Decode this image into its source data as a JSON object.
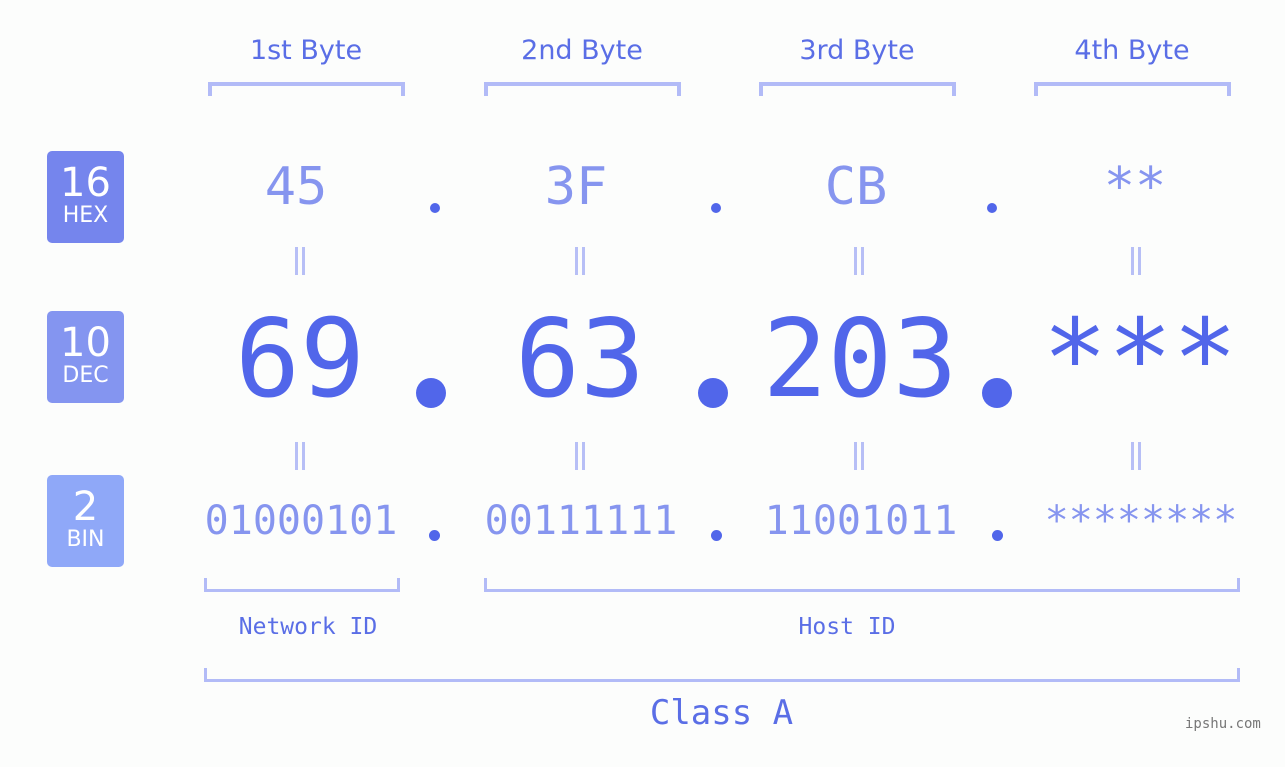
{
  "colors": {
    "hex_badge": "#7585ed",
    "dec_badge": "#8495f0",
    "bin_badge": "#8fa8f8",
    "accent": "#5166ea",
    "light_value": "#8695ef",
    "bracket": "#b2bbf7",
    "background": "#fcfdfc"
  },
  "bases": [
    {
      "number": "16",
      "label": "HEX"
    },
    {
      "number": "10",
      "label": "DEC"
    },
    {
      "number": "2",
      "label": "BIN"
    }
  ],
  "byte_headers": [
    "1st Byte",
    "2nd Byte",
    "3rd Byte",
    "4th Byte"
  ],
  "hex_values": [
    "45",
    "3F",
    "CB",
    "**"
  ],
  "dec_values": [
    "69",
    "63",
    "203",
    "***"
  ],
  "bin_values": [
    "01000101",
    "00111111",
    "11001011",
    "********"
  ],
  "equals_symbol": "=",
  "separator": ".",
  "network_id_label": "Network ID",
  "host_id_label": "Host ID",
  "class_label": "Class A",
  "watermark": "ipshu.com"
}
